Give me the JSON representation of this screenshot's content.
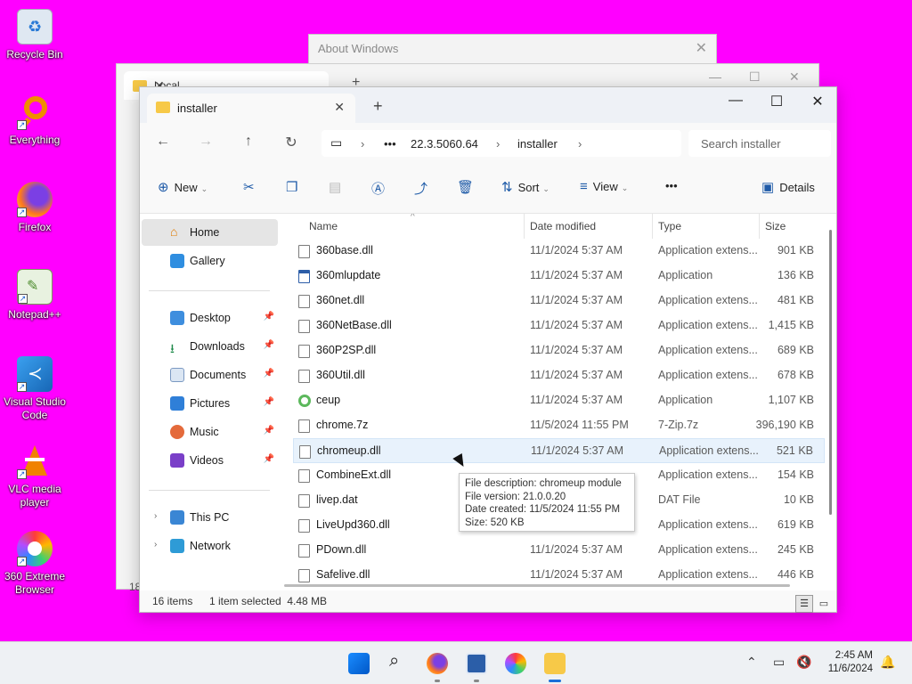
{
  "desktop": {
    "icons": [
      {
        "label": "Recycle Bin",
        "icon": "recycle-bin-icon"
      },
      {
        "label": "Everything",
        "icon": "magnifier-icon"
      },
      {
        "label": "Firefox",
        "icon": "firefox-icon"
      },
      {
        "label": "Notepad++",
        "icon": "notepad-plus-plus-icon"
      },
      {
        "label": "Visual Studio Code",
        "icon": "vscode-icon"
      },
      {
        "label": "VLC media player",
        "icon": "vlc-icon"
      },
      {
        "label": "360 Extreme Browser",
        "icon": "browser-360-icon"
      }
    ]
  },
  "background_windows": {
    "about_title": "About Windows",
    "local_tab": "Local"
  },
  "explorer": {
    "tab_title": "installer",
    "breadcrumb": [
      "22.3.5060.64",
      "installer"
    ],
    "search_placeholder": "Search installer",
    "toolbar": {
      "new": "New",
      "sort": "Sort",
      "view": "View",
      "more": "•••",
      "details": "Details"
    },
    "nav": {
      "home": "Home",
      "gallery": "Gallery",
      "desktop": "Desktop",
      "downloads": "Downloads",
      "documents": "Documents",
      "pictures": "Pictures",
      "music": "Music",
      "videos": "Videos",
      "this_pc": "This PC",
      "network": "Network"
    },
    "columns": {
      "name": "Name",
      "date": "Date modified",
      "type": "Type",
      "size": "Size"
    },
    "files": [
      {
        "name": "360base.dll",
        "date": "11/1/2024 5:37 AM",
        "type": "Application extens...",
        "size": "901 KB",
        "kind": "dll"
      },
      {
        "name": "360mlupdate",
        "date": "11/1/2024 5:37 AM",
        "type": "Application",
        "size": "136 KB",
        "kind": "app"
      },
      {
        "name": "360net.dll",
        "date": "11/1/2024 5:37 AM",
        "type": "Application extens...",
        "size": "481 KB",
        "kind": "dll"
      },
      {
        "name": "360NetBase.dll",
        "date": "11/1/2024 5:37 AM",
        "type": "Application extens...",
        "size": "1,415 KB",
        "kind": "dll"
      },
      {
        "name": "360P2SP.dll",
        "date": "11/1/2024 5:37 AM",
        "type": "Application extens...",
        "size": "689 KB",
        "kind": "dll"
      },
      {
        "name": "360Util.dll",
        "date": "11/1/2024 5:37 AM",
        "type": "Application extens...",
        "size": "678 KB",
        "kind": "dll"
      },
      {
        "name": "ceup",
        "date": "11/1/2024 5:37 AM",
        "type": "Application",
        "size": "1,107 KB",
        "kind": "green"
      },
      {
        "name": "chrome.7z",
        "date": "11/5/2024 11:55 PM",
        "type": "7-Zip.7z",
        "size": "396,190 KB",
        "kind": "file"
      },
      {
        "name": "chromeup.dll",
        "date": "11/1/2024 5:37 AM",
        "type": "Application extens...",
        "size": "521 KB",
        "kind": "dll"
      },
      {
        "name": "CombineExt.dll",
        "date": "",
        "type": "Application extens...",
        "size": "154 KB",
        "kind": "dll"
      },
      {
        "name": "livep.dat",
        "date": "",
        "type": "DAT File",
        "size": "10 KB",
        "kind": "file"
      },
      {
        "name": "LiveUpd360.dll",
        "date": "11/1/2024 5:37 AM",
        "type": "Application extens...",
        "size": "619 KB",
        "kind": "dll"
      },
      {
        "name": "PDown.dll",
        "date": "11/1/2024 5:37 AM",
        "type": "Application extens...",
        "size": "245 KB",
        "kind": "dll"
      },
      {
        "name": "Safelive.dll",
        "date": "11/1/2024 5:37 AM",
        "type": "Application extens...",
        "size": "446 KB",
        "kind": "dll"
      }
    ],
    "tooltip": {
      "line1": "File description: chromeup module",
      "line2": "File version: 21.0.0.20",
      "line3": "Date created: 11/5/2024 11:55 PM",
      "line4": "Size: 520 KB"
    },
    "status": {
      "items": "16 items",
      "selected": "1 item selected  4.48 MB"
    },
    "local_status_fragment": "18"
  },
  "taskbar": {
    "time": "2:45 AM",
    "date": "11/6/2024"
  }
}
